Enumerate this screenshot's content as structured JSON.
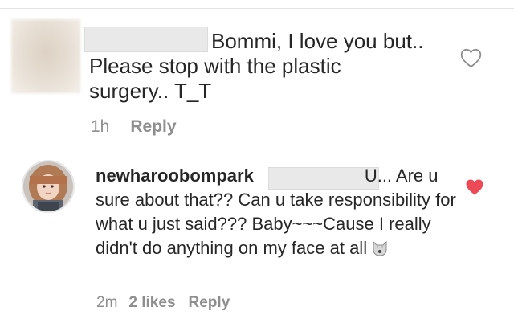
{
  "comment1": {
    "text": "Bommi, I love you but.. Please stop with the plastic surgery.. T_T",
    "time": "1h",
    "reply_label": "Reply"
  },
  "comment2": {
    "username": "newharoobompark",
    "text_before_gap": "",
    "text": "U... Are u sure about that?? Can u take responsibility for what u just said??? Baby~~~Cause I really didn't do anything on my face at all",
    "time": "2m",
    "likes": "2 likes",
    "reply_label": "Reply"
  },
  "icons": {
    "like_outline": "heart-outline-icon",
    "like_filled": "heart-filled-icon",
    "emoji": "cat-face-emoji-icon"
  },
  "colors": {
    "text": "#262626",
    "meta": "#8e8e8e",
    "liked_heart": "#ed4956"
  }
}
